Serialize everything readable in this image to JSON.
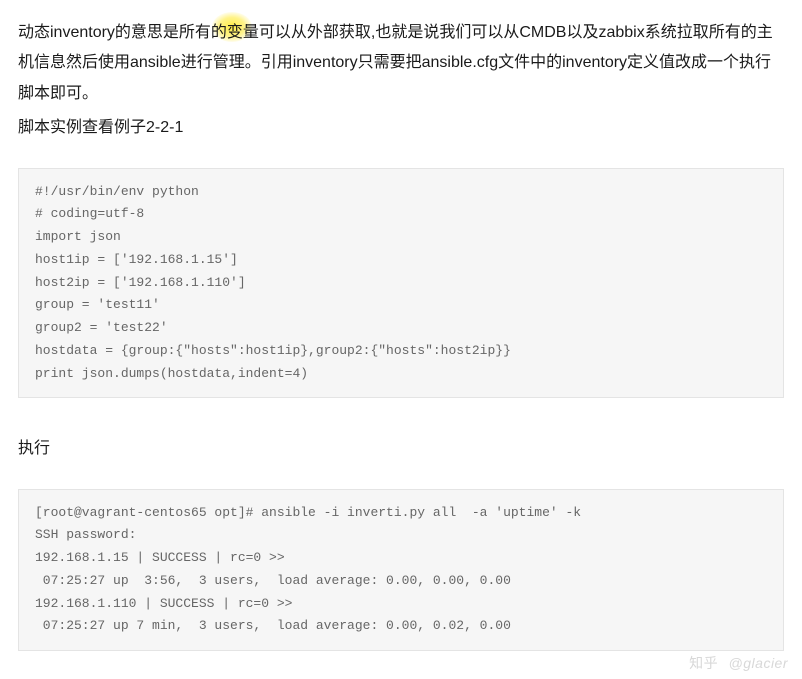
{
  "intro": {
    "p1": "动态inventory的意思是所有的变量可以从外部获取,也就是说我们可以从CMDB以及zabbix系统拉取所有的主机信息然后使用ansible进行管理。引用inventory只需要把ansible.cfg文件中的inventory定义值改成一个执行脚本即可。",
    "p2": "脚本实例查看例子2-2-1"
  },
  "code1": "#!/usr/bin/env python\n# coding=utf-8\nimport json\nhost1ip = ['192.168.1.15']\nhost2ip = ['192.168.1.110']\ngroup = 'test11'\ngroup2 = 'test22'\nhostdata = {group:{\"hosts\":host1ip},group2:{\"hosts\":host2ip}}\nprint json.dumps(hostdata,indent=4)",
  "heading1": "执行",
  "code2": "[root@vagrant-centos65 opt]# ansible -i inverti.py all  -a 'uptime' -k\nSSH password:\n192.168.1.15 | SUCCESS | rc=0 >>\n 07:25:27 up  3:56,  3 users,  load average: 0.00, 0.00, 0.00\n192.168.1.110 | SUCCESS | rc=0 >>\n 07:25:27 up 7 min,  3 users,  load average: 0.00, 0.02, 0.00",
  "watermark": {
    "site": "知乎",
    "user": "@glacier"
  }
}
